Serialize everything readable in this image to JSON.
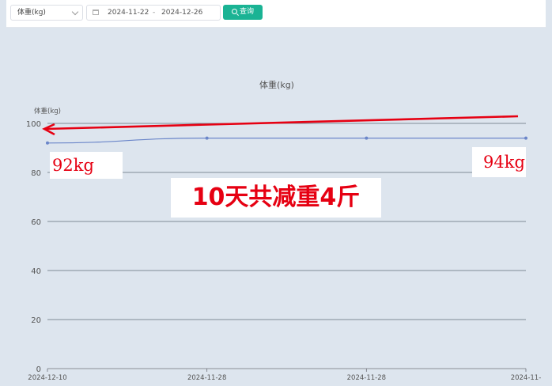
{
  "filter": {
    "metric_select_value": "体重(kg)",
    "date_start": "2024-11-22",
    "date_separator": "-",
    "date_end": "2024-12-26",
    "query_label": "查询"
  },
  "chart_data": {
    "type": "line",
    "title": "体重(kg)",
    "ylabel": "体重(kg)",
    "xlabel": "",
    "ylim": [
      0,
      100
    ],
    "yticks": [
      0,
      20,
      40,
      60,
      80,
      100
    ],
    "grid": true,
    "categories": [
      "2024-12-10",
      "2024-11-28",
      "2024-11-28",
      "2024-11-"
    ],
    "series": [
      {
        "values": [
          92,
          94,
          94,
          94
        ],
        "color": "#6b86c9"
      }
    ]
  },
  "annotations": {
    "left_weight": "92kg",
    "right_weight": "94kg",
    "headline": "10天共减重4斤",
    "arrow_color": "#e60012"
  }
}
